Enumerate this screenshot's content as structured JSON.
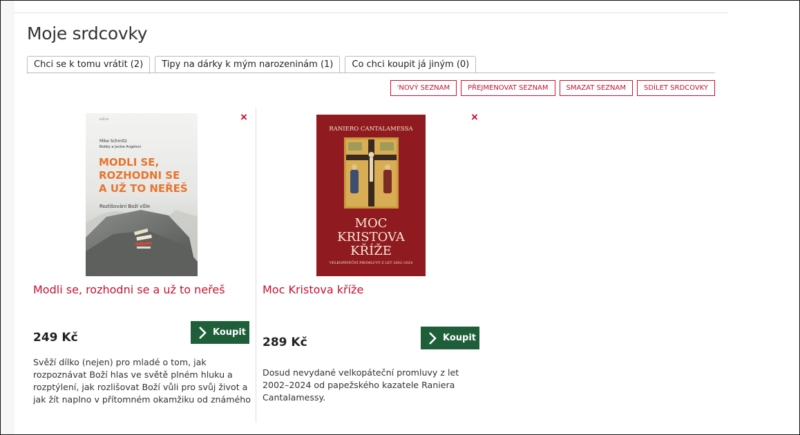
{
  "page": {
    "title": "Moje srdcovky"
  },
  "tabs": [
    {
      "label": "Chci se k tomu vrátit (2)",
      "active": true
    },
    {
      "label": "Tipy na dárky k mým narozeninám (1)",
      "active": false
    },
    {
      "label": "Co chci koupit já jiným (0)",
      "active": false
    }
  ],
  "actions": {
    "new_list": "'NOVÝ SEZNAM",
    "rename_list": "PŘEJMENOVAT SEZNAM",
    "delete_list": "SMAZAT SEZNAM",
    "share": "SDÍLET SRDCOVKY"
  },
  "products": [
    {
      "title": "Modli se, rozhodni se a už to neřeš",
      "price": "249 Kč",
      "buy_label": "Koupit",
      "remove_symbol": "×",
      "description": "Svěží dílko (nejen) pro mladé o tom, jak rozpoznávat Boží hlas ve světě plném hluku a rozptýlení, jak rozlišovat Boží vůli pro svůj život a jak žít naplno v přítomném okamžiku od známého",
      "cover": {
        "authors": "Mike Schmitz",
        "authors2": "Bobby a Jackie Angelovi",
        "title_lines": [
          "MODLI SE,",
          "ROZHODNI SE",
          "A UŽ TO NEŘEŠ"
        ],
        "subtitle": "Rozlišování Boží vůle",
        "series": "edice"
      }
    },
    {
      "title": "Moc Kristova kříže",
      "price": "289 Kč",
      "buy_label": "Koupit",
      "remove_symbol": "×",
      "description": "Dosud nevydané velkopáteční promluvy z let 2002–2024 od papežského kazatele Raniera Cantalamessy.",
      "cover": {
        "author": "RANIERO CANTALAMESSA",
        "title_lines": [
          "MOC",
          "KRISTOVA",
          "KŘÍŽE"
        ],
        "subtitle": "VELKOPÁTEČNÍ PROMLUVY Z LET 2002–2024"
      }
    }
  ],
  "colors": {
    "accent": "#c8102e",
    "buy_button": "#1e5f3a",
    "cover2_bg": "#8f1a1f"
  }
}
